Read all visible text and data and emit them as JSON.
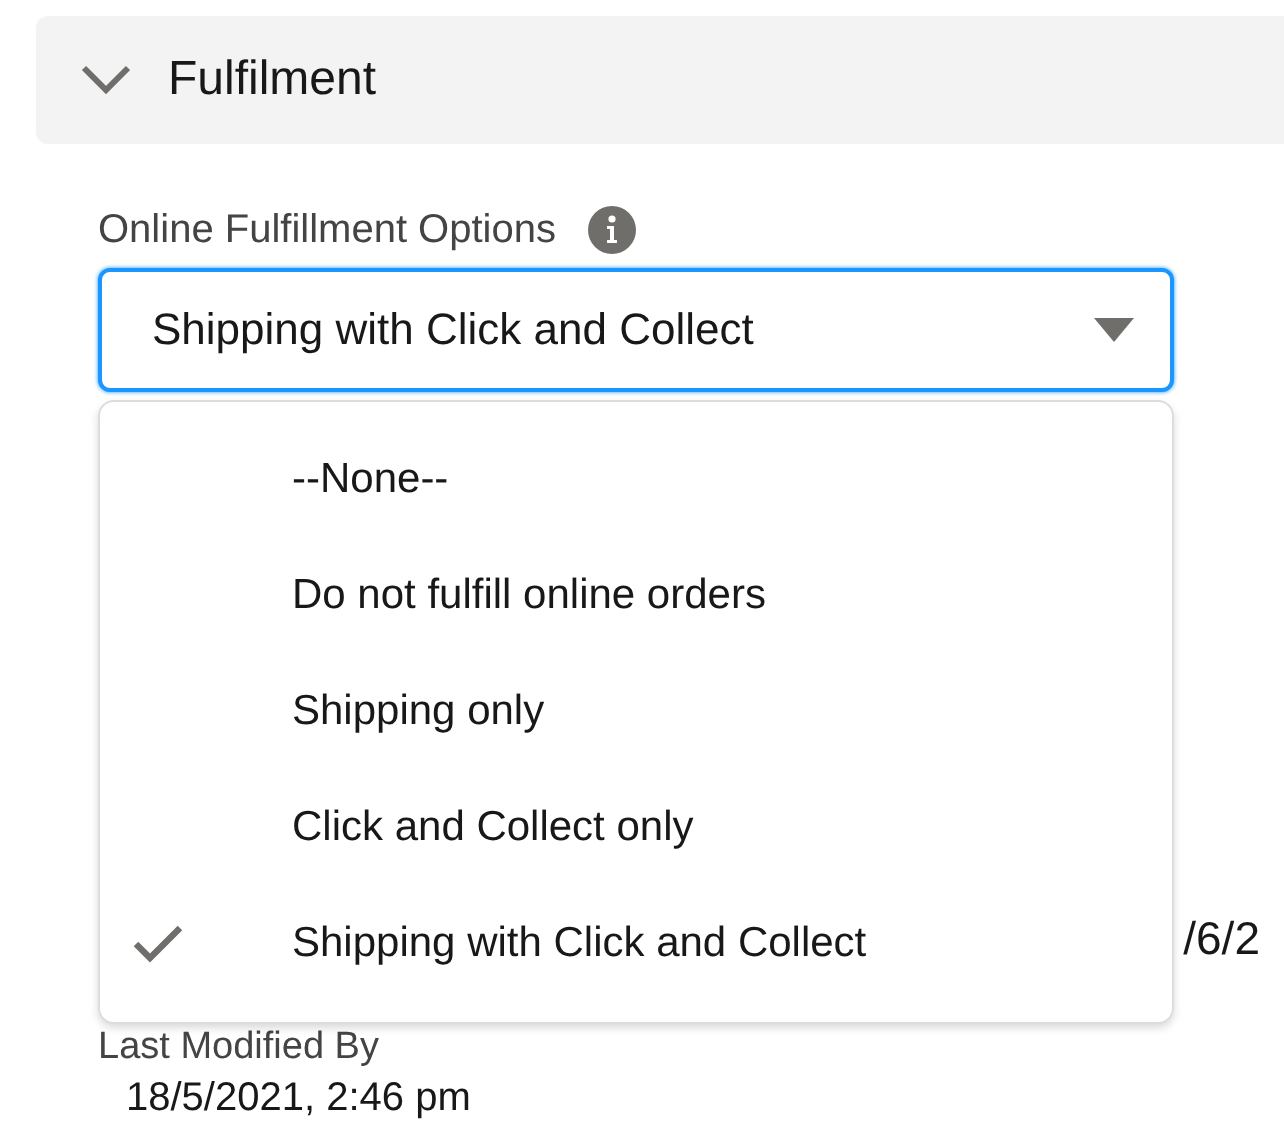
{
  "section": {
    "title": "Fulfilment",
    "expanded": true
  },
  "field": {
    "label": "Online Fulfillment Options",
    "value": "Shipping with Click and Collect",
    "open": true,
    "options": [
      {
        "label": "--None--",
        "selected": false
      },
      {
        "label": "Do not fulfill online orders",
        "selected": false
      },
      {
        "label": "Shipping only",
        "selected": false
      },
      {
        "label": "Click and Collect only",
        "selected": false
      },
      {
        "label": "Shipping with Click and Collect",
        "selected": true
      }
    ]
  },
  "side_value": "/6/2",
  "last_modified": {
    "label": "Last Modified By",
    "value": "18/5/2021, 2:46 pm"
  }
}
